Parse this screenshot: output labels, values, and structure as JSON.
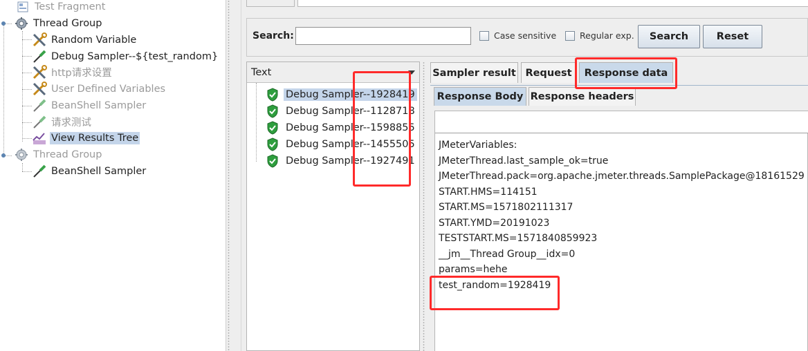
{
  "tree": {
    "nodes": [
      {
        "label": "Test Fragment",
        "disabled": true
      },
      {
        "label": "Thread Group",
        "disabled": false
      },
      {
        "label": "Random Variable",
        "disabled": false
      },
      {
        "label": "Debug Sampler--${test_random}",
        "disabled": false
      },
      {
        "label": "http请求设置",
        "disabled": true
      },
      {
        "label": "User Defined Variables",
        "disabled": true
      },
      {
        "label": "BeanShell Sampler",
        "disabled": true
      },
      {
        "label": "请求测试",
        "disabled": true
      },
      {
        "label": "View Results Tree",
        "disabled": false,
        "selected": true
      },
      {
        "label": "Thread Group",
        "disabled": true
      },
      {
        "label": "BeanShell Sampler",
        "disabled": false
      }
    ]
  },
  "search": {
    "label": "Search:",
    "value": "",
    "case_sensitive_label": "Case sensitive",
    "regex_label": "Regular exp.",
    "search_button": "Search",
    "reset_button": "Reset"
  },
  "results": {
    "header": "Text",
    "items": [
      {
        "label": "Debug Sampler--1928419",
        "selected": true
      },
      {
        "label": "Debug Sampler--1128718"
      },
      {
        "label": "Debug Sampler--1598855"
      },
      {
        "label": "Debug Sampler--1455505"
      },
      {
        "label": "Debug Sampler--1927491"
      }
    ]
  },
  "detail": {
    "tabs": [
      "Sampler result",
      "Request",
      "Response data"
    ],
    "active_tab": "Response data",
    "inner_tabs": [
      "Response Body",
      "Response headers"
    ],
    "active_inner_tab": "Response Body",
    "body_lines": [
      "JMeterVariables:",
      "JMeterThread.last_sample_ok=true",
      "JMeterThread.pack=org.apache.jmeter.threads.SamplePackage@18161529",
      "START.HMS=114151",
      "START.MS=1571802111317",
      "START.YMD=20191023",
      "TESTSTART.MS=1571840859923",
      "__jm__Thread Group__idx=0",
      "params=hehe",
      "test_random=1928419"
    ]
  },
  "colors": {
    "highlight": "#c4d5ea",
    "annotation": "#ff2a2a",
    "active_tab": "#c9d9ea"
  }
}
